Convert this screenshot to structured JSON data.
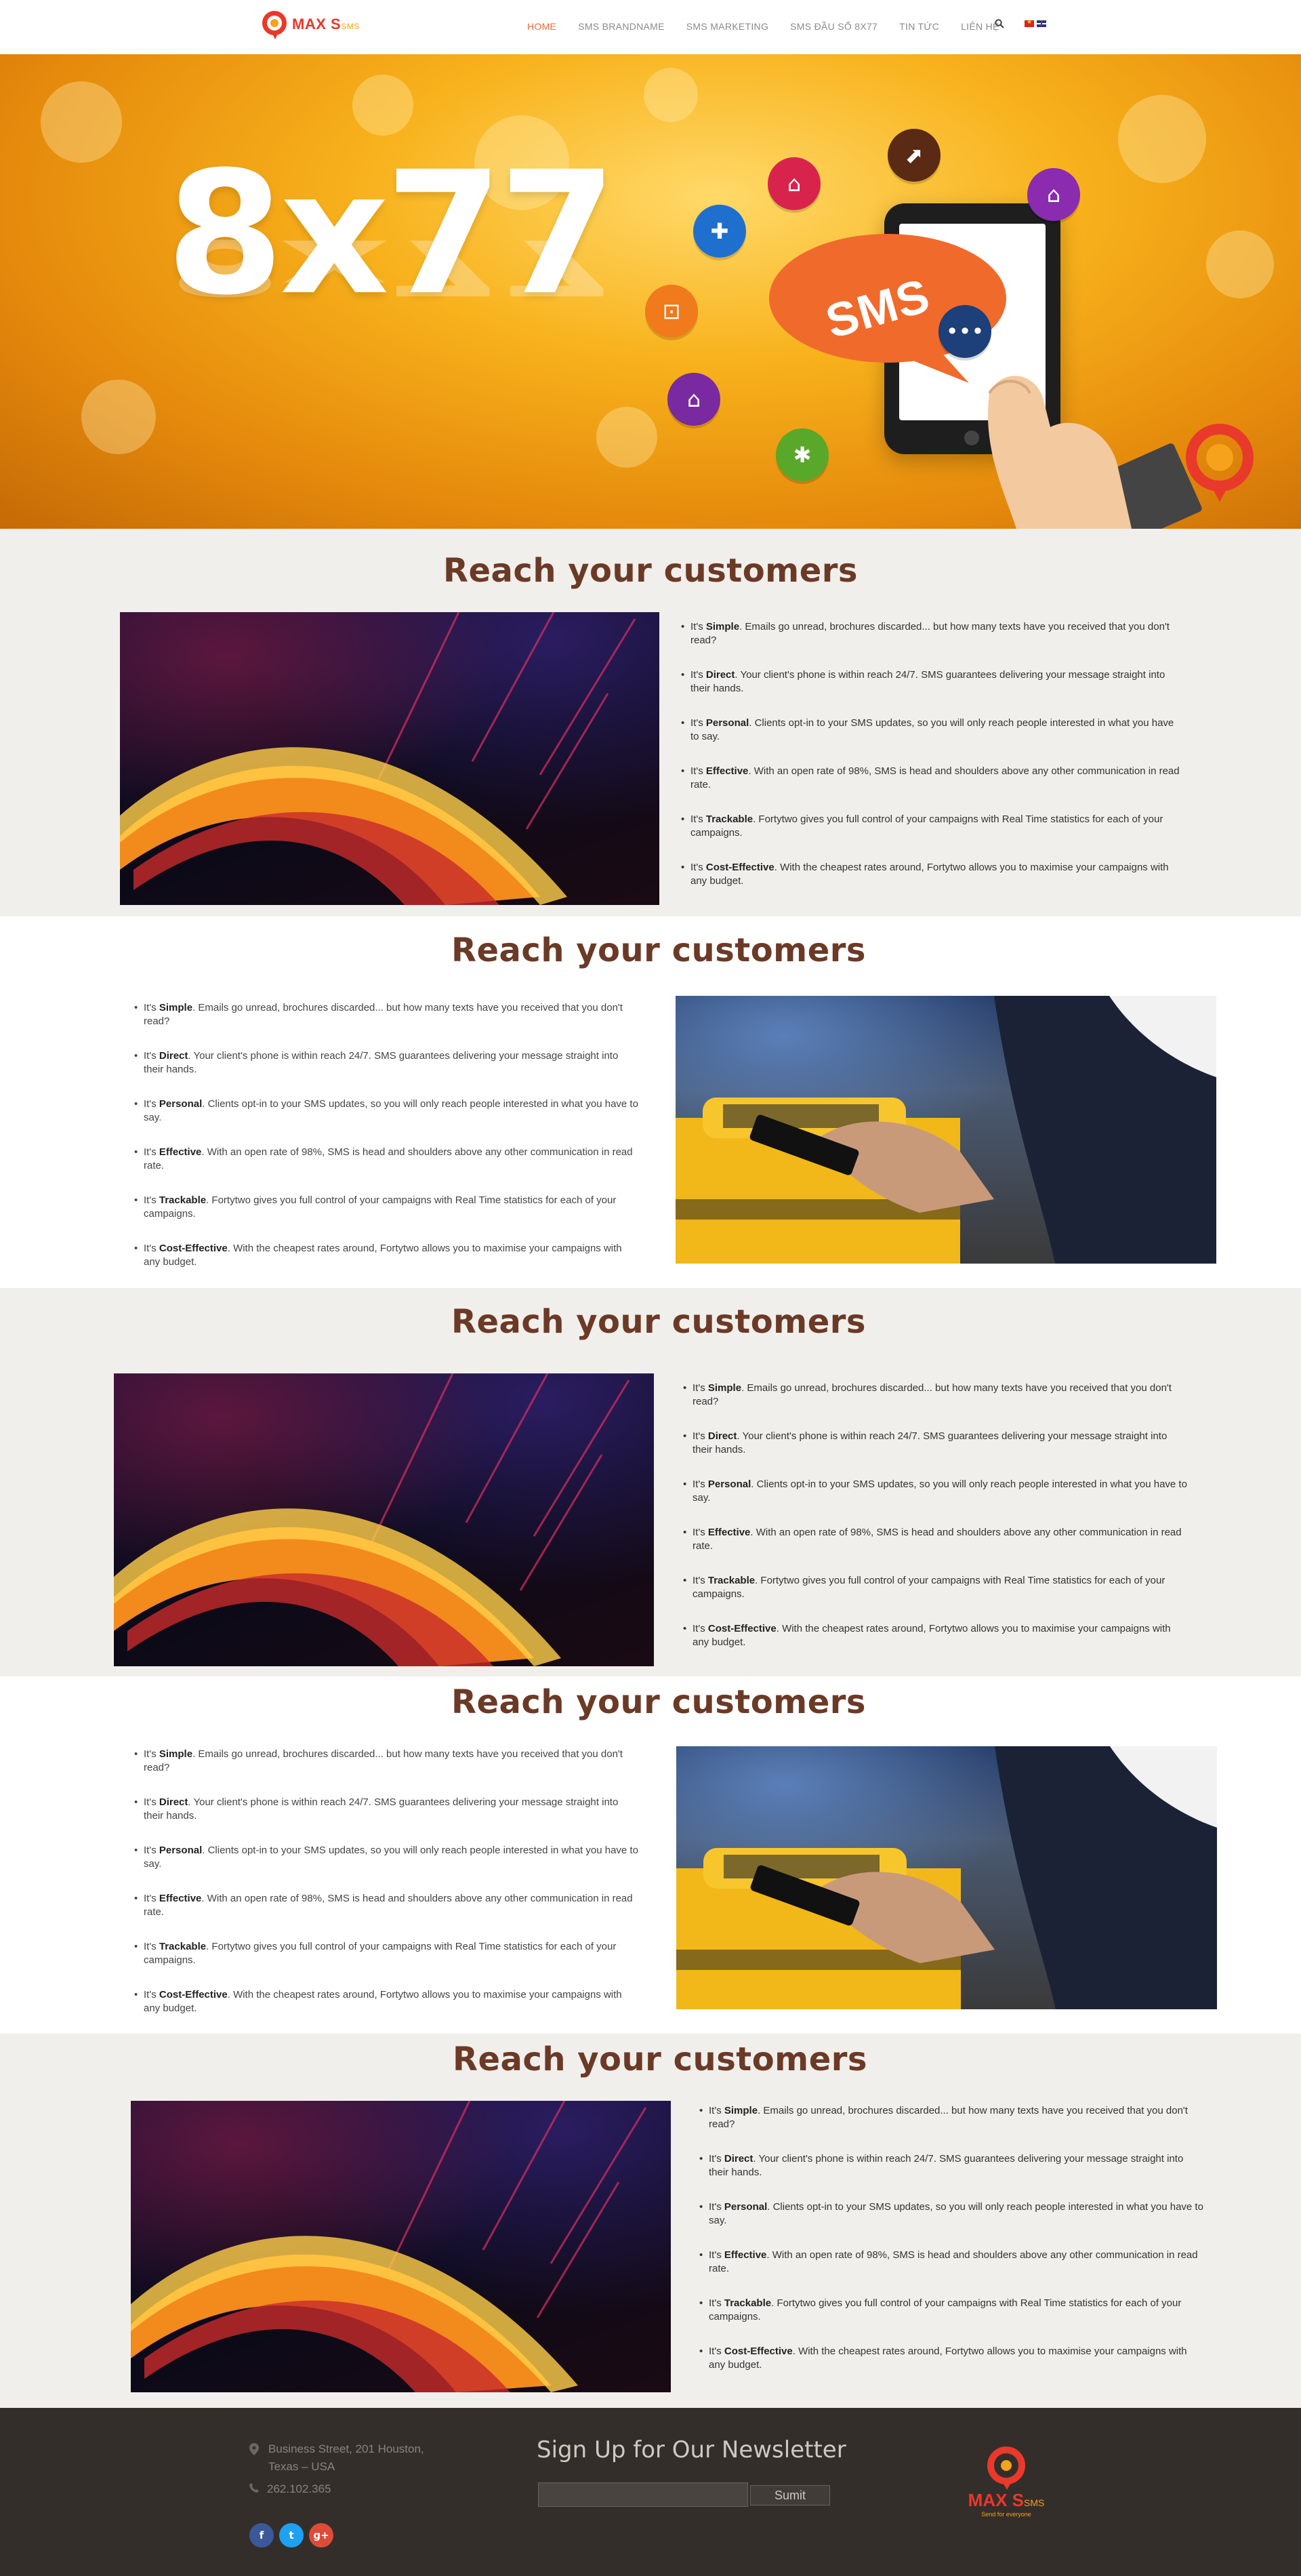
{
  "nav": {
    "brand": "MAX S",
    "brand_suffix": "SMS",
    "items": [
      {
        "label": "HOME",
        "active": true
      },
      {
        "label": "SMS BRANDNAME",
        "active": false
      },
      {
        "label": "SMS MARKETING",
        "active": false
      },
      {
        "label": "SMS ĐẦU SỐ 8X77",
        "active": false
      },
      {
        "label": "TIN TỨC",
        "active": false
      },
      {
        "label": "LIÊN HỆ",
        "active": false
      }
    ],
    "icons": [
      "search-icon",
      "flag-vn-icon",
      "flag-en-icon"
    ]
  },
  "hero": {
    "title": "8x77",
    "bubble_text": "SMS",
    "colors": {
      "bg_light": "#ffd968",
      "bg_dark": "#c56a06",
      "bubble": "#f06a2c"
    }
  },
  "sections": [
    {
      "title": "Reach your customers",
      "image": "abstract-wave",
      "image_side": "left"
    },
    {
      "title": "Reach your customers",
      "image": "taxi-phone",
      "image_side": "right"
    },
    {
      "title": "Reach your customers",
      "image": "abstract-wave",
      "image_side": "left"
    },
    {
      "title": "Reach your customers",
      "image": "taxi-phone",
      "image_side": "right"
    },
    {
      "title": "Reach your customers",
      "image": "abstract-wave",
      "image_side": "left"
    }
  ],
  "bullets": [
    {
      "pre": "It's ",
      "bold": "Simple",
      "text": ". Emails go unread, brochures discarded... but how many texts have you received that you don't read?"
    },
    {
      "pre": "It's ",
      "bold": "Direct",
      "text": ". Your client's phone is within reach 24/7. SMS guarantees delivering your message straight into their hands."
    },
    {
      "pre": "It's ",
      "bold": "Personal",
      "text": ". Clients opt-in to your SMS updates, so you will only reach people interested in what you have to say."
    },
    {
      "pre": "It's ",
      "bold": "Effective",
      "text": ". With an open rate of 98%, SMS is head and shoulders above any other communication in read rate."
    },
    {
      "pre": "It's ",
      "bold": "Trackable",
      "text": ". Fortytwo gives you full control of your campaigns with Real Time statistics for each of your campaigns."
    },
    {
      "pre": "It's ",
      "bold": "Cost-Effective",
      "text": ". With the cheapest rates around, Fortytwo allows you to maximise your campaigns with any budget."
    }
  ],
  "footer": {
    "address_line1": "Business Street, 201 Houston,",
    "address_line2": "Texas – USA",
    "phone": "262.102.365",
    "newsletter_title": "Sign Up for Our Newsletter",
    "submit_label": "Sumit",
    "input_placeholder": "",
    "social": [
      "facebook-icon",
      "twitter-icon",
      "google-plus-icon"
    ],
    "brand": "MAX S",
    "brand_suffix": "SMS",
    "tagline": "Send for everyone",
    "colors": {
      "bg": "#342e2a",
      "facebook": "#3b5998",
      "twitter": "#1da1f2",
      "google": "#dd4b39"
    }
  }
}
